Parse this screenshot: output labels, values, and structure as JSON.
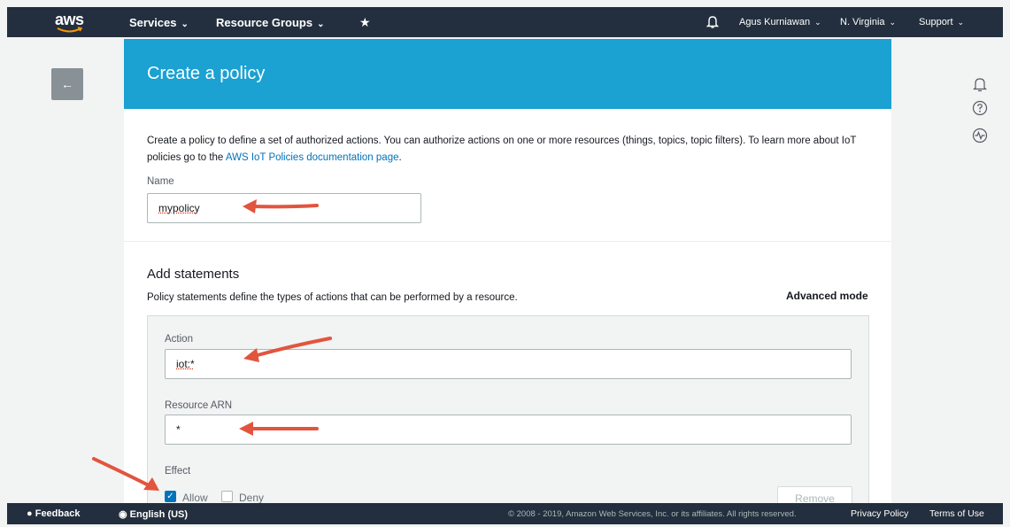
{
  "topnav": {
    "logo_text": "aws",
    "services_label": "Services",
    "resource_groups_label": "Resource Groups",
    "user_label": "Agus Kurniawan",
    "region_label": "N. Virginia",
    "support_label": "Support"
  },
  "page": {
    "title": "Create a policy",
    "intro_text": "Create a policy to define a set of authorized actions. You can authorize actions on one or more resources (things, topics, topic filters). To learn more about IoT policies go to the ",
    "intro_link": "AWS IoT Policies documentation page",
    "intro_end": "."
  },
  "name_field": {
    "label": "Name",
    "value": "mypolicy"
  },
  "statements": {
    "title": "Add statements",
    "description": "Policy statements define the types of actions that can be performed by a resource.",
    "advanced_mode_label": "Advanced mode",
    "action_label": "Action",
    "action_value": "iot:*",
    "resource_label": "Resource ARN",
    "resource_value": "*",
    "effect_label": "Effect",
    "allow_label": "Allow",
    "deny_label": "Deny",
    "allow_checked": true,
    "deny_checked": false,
    "remove_label": "Remove"
  },
  "footer": {
    "feedback_label": "Feedback",
    "language_label": "English (US)",
    "copyright": "© 2008 - 2019, Amazon Web Services, Inc. or its affiliates. All rights reserved.",
    "privacy_label": "Privacy Policy",
    "terms_label": "Terms of Use"
  },
  "colors": {
    "nav_bg": "#232f3e",
    "header_blue": "#1ba1d2",
    "link_blue": "#0073bb",
    "arrow_red": "#e2543e"
  },
  "icons": {
    "back": "arrow-left-icon",
    "bell": "bell-icon",
    "help": "help-circle-icon",
    "health": "health-pulse-icon",
    "pin": "pin-icon",
    "feedback": "speech-bubble-icon",
    "language": "globe-icon"
  }
}
